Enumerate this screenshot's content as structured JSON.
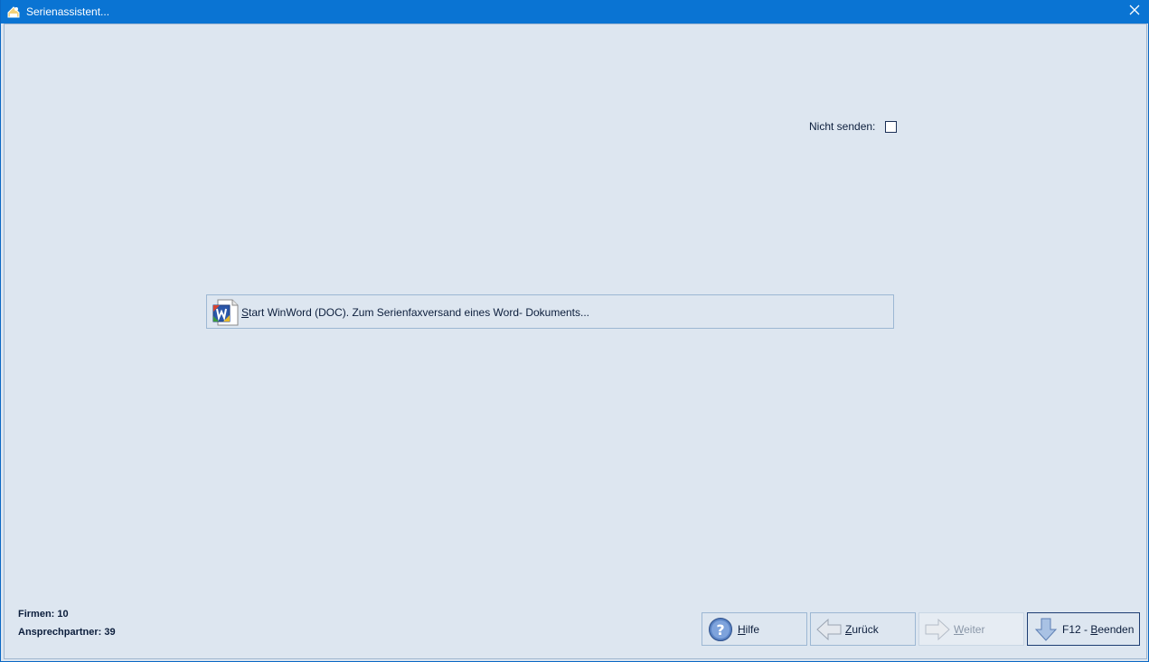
{
  "window": {
    "title": "Serienassistent..."
  },
  "options": {
    "nicht_senden_label": "Nicht senden:",
    "nicht_senden_checked": false
  },
  "winword_button": {
    "label_accel": "S",
    "label_rest": "tart WinWord (DOC). Zum Serienfaxversand eines Word- Dokuments..."
  },
  "stats": {
    "firmen": "Firmen: 10",
    "ansprechpartner": "Ansprechpartner: 39"
  },
  "nav": {
    "hilfe": {
      "accel": "H",
      "rest": "ilfe"
    },
    "zurueck": {
      "accel": "Z",
      "rest": "urück"
    },
    "weiter": {
      "accel": "W",
      "rest": "eiter",
      "enabled": false
    },
    "beenden": {
      "prefix": "F12 - ",
      "accel": "B",
      "rest": "eenden"
    }
  },
  "colors": {
    "titlebar": "#0a74d3",
    "background": "#dde6f0",
    "text": "#0c1e3c",
    "disabled_text": "#8a97a8"
  },
  "icons": {
    "title": "app-icon",
    "close": "close-icon",
    "winword": "word-document-icon",
    "hilfe": "help-icon",
    "zurueck": "arrow-left-icon",
    "weiter": "arrow-right-icon",
    "beenden": "arrow-down-icon"
  }
}
